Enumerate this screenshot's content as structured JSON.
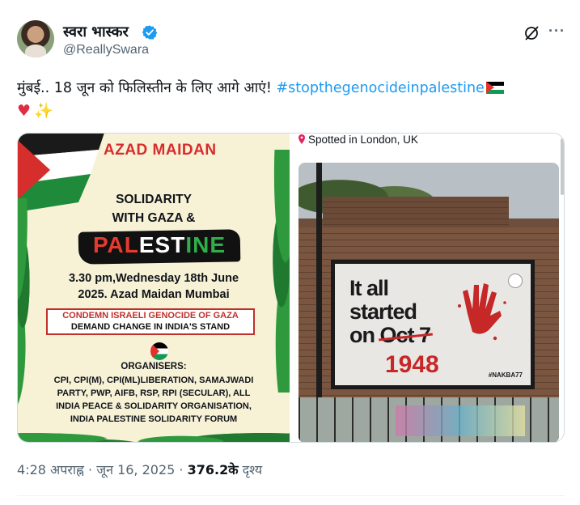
{
  "author": {
    "display_name": "स्वरा भास्कर",
    "handle": "@ReallySwara",
    "verified": true
  },
  "header_icons": [
    "grok-icon",
    "more-icon"
  ],
  "tweet": {
    "text": "मुंबई.. 18 जून को फिलिस्तीन के लिए आगे आएं!",
    "hashtag": "#stopthegenocideinpalestine",
    "emojis": [
      "palestine-flag",
      "red-heart",
      "sparkles"
    ]
  },
  "poster": {
    "title": "AZAD MAIDAN",
    "solidarity_line1": "SOLIDARITY",
    "solidarity_line2": "WITH GAZA &",
    "palestine_pal": "PAL",
    "palestine_est": "EST",
    "palestine_ine": "INE",
    "time_line1": "3.30 pm,Wednesday 18th June",
    "time_line2": "2025.  Azad Maidan Mumbai",
    "condemn_line1": "CONDEMN ISRAELI GENOCIDE OF GAZA",
    "condemn_line2": "DEMAND CHANGE IN INDIA'S STAND",
    "organisers_label": "ORGANISERS:",
    "organisers": [
      "CPI, CPI(M), CPI(ML)LIBERATION, SAMAJWADI",
      "PARTY, PWP, AIFB, RSP, RPI (SECULAR), ALL",
      "INDIA PEACE & SOLIDARITY ORGANISATION,",
      "INDIA PALESTINE SOLIDARITY FORUM"
    ]
  },
  "photo": {
    "location": "Spotted in London, UK",
    "billboard_line1": "It all",
    "billboard_line2": "started",
    "billboard_on": "on",
    "billboard_oct": "Oct 7",
    "billboard_year": "1948",
    "billboard_tag": "#NAKBA77"
  },
  "meta": {
    "time": "4:28 अपराह्न",
    "sep1": " · ",
    "date": "जून 16, 2025",
    "sep2": " · ",
    "views_count": "376.2के",
    "views_label": " दृश्य"
  },
  "colors": {
    "link": "#1d9bf0",
    "secondary_text": "#536471",
    "verified": "#1d9bf0",
    "poster_red": "#d62d2d"
  }
}
